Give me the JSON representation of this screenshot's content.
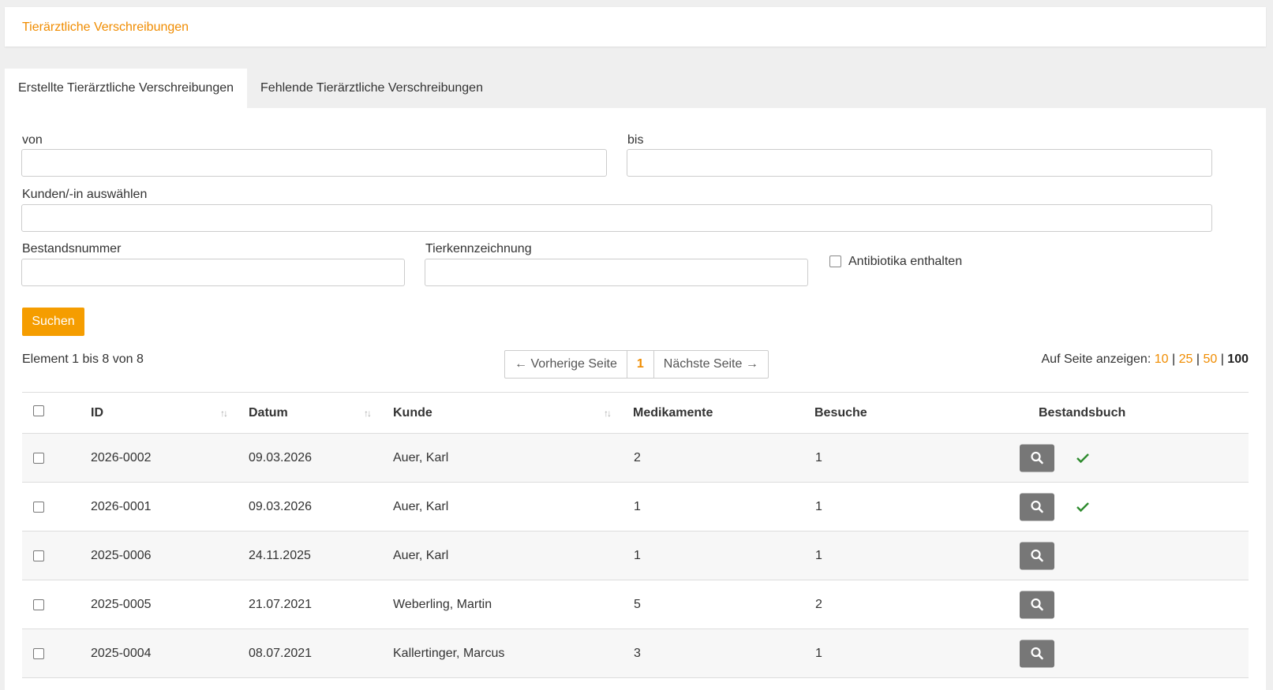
{
  "header": {
    "title": "Tierärztliche Verschreibungen"
  },
  "tabs": [
    {
      "label": "Erstellte Tierärztliche Verschreibungen",
      "active": true
    },
    {
      "label": "Fehlende Tierärztliche Verschreibungen",
      "active": false
    }
  ],
  "filters": {
    "from_label": "von",
    "to_label": "bis",
    "customer_label": "Kunden/-in auswählen",
    "stock_label": "Bestandsnummer",
    "animal_label": "Tierkennzeichnung",
    "antibiotics_label": "Antibiotika enthalten",
    "search_button": "Suchen"
  },
  "results": {
    "count_text": "Element 1 bis 8 von 8"
  },
  "pagination": {
    "prev": "← Vorherige Seite",
    "current": "1",
    "next": "Nächste Seite →"
  },
  "per_page": {
    "label": "Auf Seite anzeigen:",
    "options": [
      "10",
      "25",
      "50",
      "100"
    ],
    "active": "100"
  },
  "table": {
    "columns": {
      "id": "ID",
      "date": "Datum",
      "customer": "Kunde",
      "meds": "Medikamente",
      "visits": "Besuche",
      "stockbook": "Bestandsbuch"
    },
    "rows": [
      {
        "id": "2026-0002",
        "date": "09.03.2026",
        "customer": "Auer, Karl",
        "meds": "2",
        "visits": "1",
        "stockbook": true
      },
      {
        "id": "2026-0001",
        "date": "09.03.2026",
        "customer": "Auer, Karl",
        "meds": "1",
        "visits": "1",
        "stockbook": true
      },
      {
        "id": "2025-0006",
        "date": "24.11.2025",
        "customer": "Auer, Karl",
        "meds": "1",
        "visits": "1",
        "stockbook": false
      },
      {
        "id": "2025-0005",
        "date": "21.07.2021",
        "customer": "Weberling, Martin",
        "meds": "5",
        "visits": "2",
        "stockbook": false
      },
      {
        "id": "2025-0004",
        "date": "08.07.2021",
        "customer": "Kallertinger, Marcus",
        "meds": "3",
        "visits": "1",
        "stockbook": false
      }
    ]
  },
  "colors": {
    "accent": "#f59d00",
    "title": "#f08c00",
    "check": "#2e8b2e",
    "view_button": "#777777"
  },
  "icons": {
    "view": "search-icon",
    "stockbook": "checkmark-icon",
    "sort": "sort-arrows-icon"
  }
}
